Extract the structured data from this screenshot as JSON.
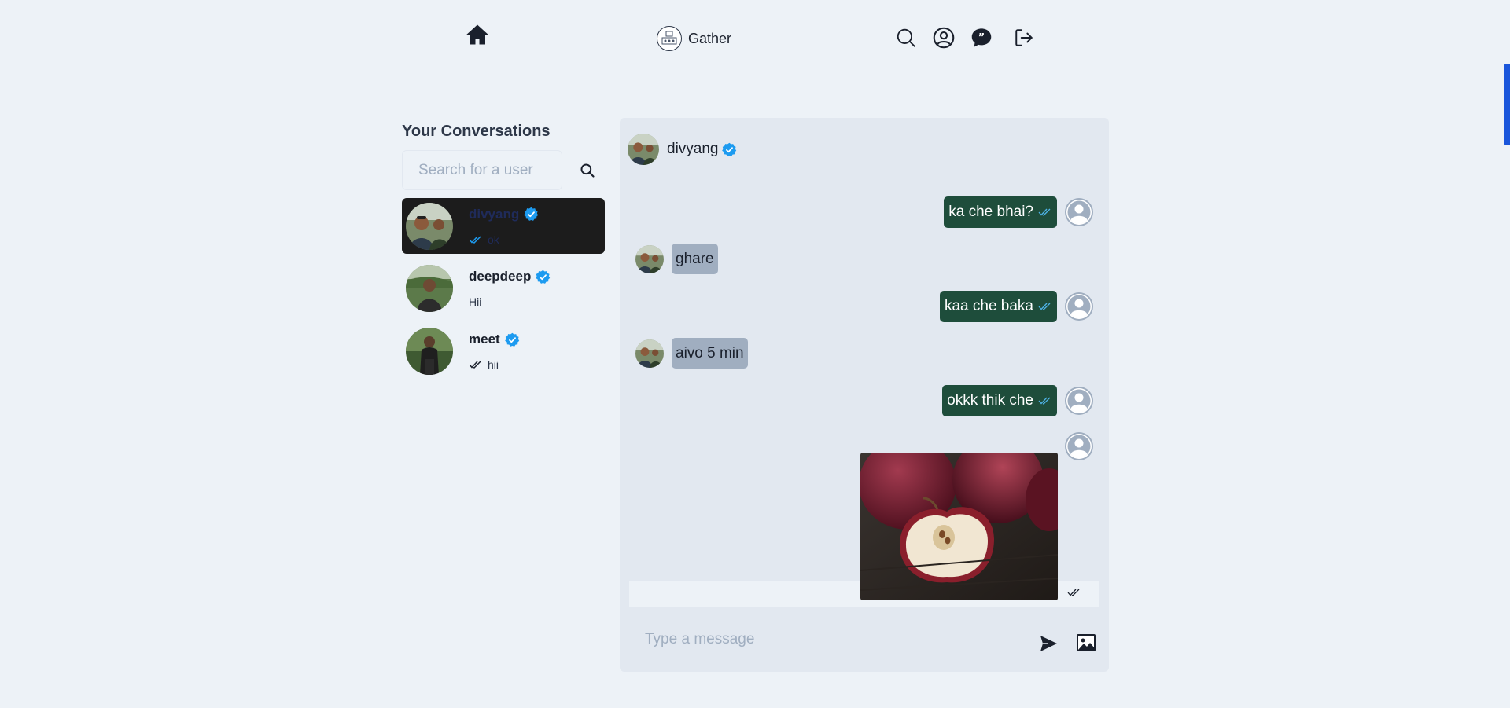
{
  "header": {
    "brand_name": "Gather",
    "icons": [
      "home-icon",
      "search-icon",
      "profile-icon",
      "chat-icon",
      "logout-icon"
    ]
  },
  "sidebar": {
    "title": "Your Conversations",
    "search_placeholder": "Search for a user",
    "conversations": [
      {
        "name": "divyang",
        "last_message": "ok",
        "verified": true,
        "seen": true,
        "active": true
      },
      {
        "name": "deepdeep",
        "last_message": "Hii",
        "verified": true,
        "seen": false,
        "active": false
      },
      {
        "name": "meet",
        "last_message": "hii",
        "verified": true,
        "seen": true,
        "active": false
      }
    ]
  },
  "chat": {
    "user": "divyang",
    "verified": true,
    "messages": [
      {
        "from": "me",
        "text": "ka che bhai?",
        "seen": true
      },
      {
        "from": "them",
        "text": "ghare"
      },
      {
        "from": "me",
        "text": "kaa che baka",
        "seen": true
      },
      {
        "from": "them",
        "text": "aivo 5 min"
      },
      {
        "from": "me",
        "text": "okkk thik che",
        "seen": true
      },
      {
        "from": "me",
        "type": "image",
        "image": "apple-photo",
        "seen": true
      }
    ],
    "composer_placeholder": "Type a message"
  },
  "colors": {
    "background": "#edf2f7",
    "panel": "#e2e8f0",
    "outgoing_bubble": "#1e4d3b",
    "incoming_bubble": "#a0aec0",
    "active_conversation": "#1c1c1c",
    "verified_badge": "#1d9bf0",
    "scroll_accent": "#1a56db"
  }
}
